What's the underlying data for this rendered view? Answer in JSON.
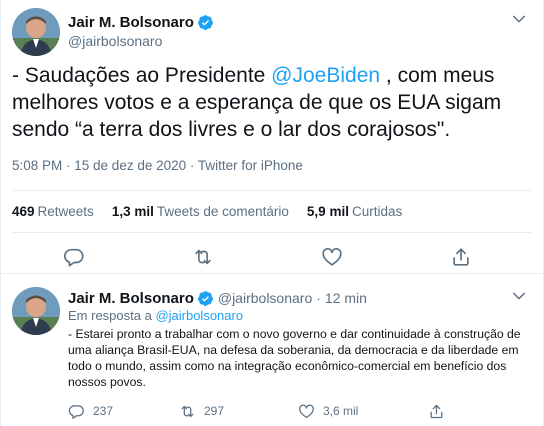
{
  "main_tweet": {
    "author_name": "Jair M. Bolsonaro",
    "author_handle": "@jairbolsonaro",
    "text_before": "- Saudações ao Presidente ",
    "mention": "@JoeBiden",
    "text_after": " , com meus melhores votos e a esperança de que os EUA sigam sendo “a terra dos livres e o lar dos corajosos\".",
    "timestamp": "5:08 PM · 15 de dez de 2020 · Twitter for iPhone",
    "stats": {
      "retweets_count": "469",
      "retweets_label": "Retweets",
      "replies_count": "1,3 mil",
      "replies_label": "Tweets de comentário",
      "likes_count": "5,9 mil",
      "likes_label": "Curtidas"
    },
    "action_icons": [
      "reply-icon",
      "retweet-icon",
      "like-icon",
      "share-icon"
    ]
  },
  "reply_tweet": {
    "author_name": "Jair M. Bolsonaro",
    "author_handle": "@jairbolsonaro",
    "separator": "·",
    "time": "12 min",
    "reply_to_prefix": "Em resposta a ",
    "reply_to_handle": "@jairbolsonaro",
    "text": "- Estarei pronto a trabalhar com o novo governo e dar continuidade à construção de uma aliança Brasil-EUA, na defesa da soberania, da democracia e da liberdade em todo o mundo, assim como na integração econômico-comercial em benefício dos nossos povos.",
    "reply_count": "237",
    "retweet_count": "297",
    "like_count": "3,6 mil"
  },
  "colors": {
    "accent": "#1da1f2",
    "text_primary": "#0f1419",
    "text_secondary": "#5b7083",
    "border": "#e6ecf0"
  }
}
